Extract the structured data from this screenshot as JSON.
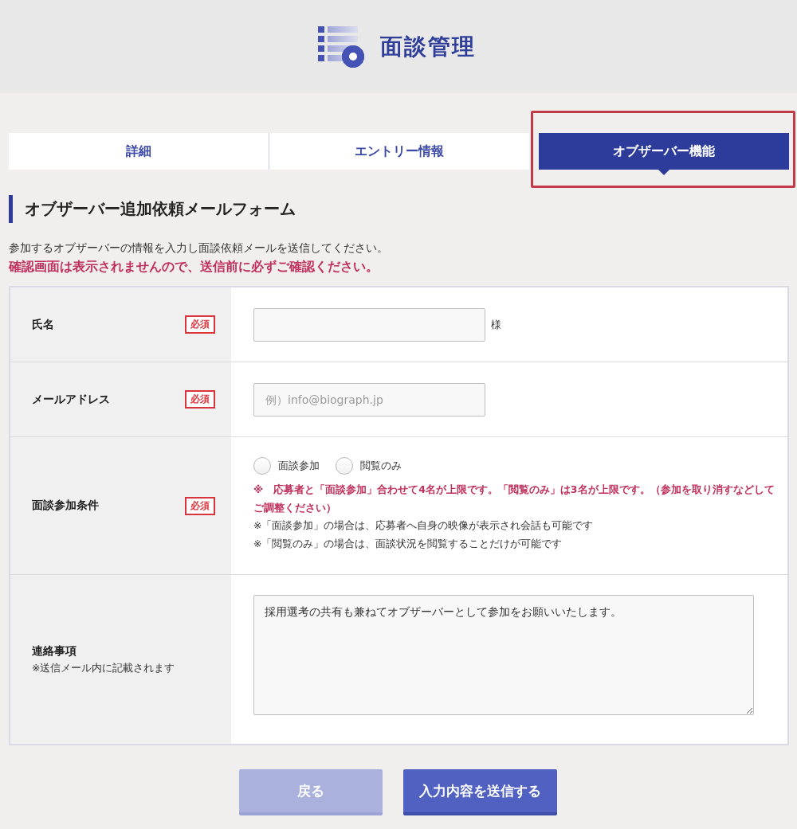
{
  "header": {
    "title": "面談管理"
  },
  "tabs": [
    {
      "label": "詳細",
      "selected": false,
      "highlighted": false
    },
    {
      "label": "エントリー情報",
      "selected": false,
      "highlighted": false
    },
    {
      "label": "オブザーバー機能",
      "selected": true,
      "highlighted": true
    }
  ],
  "section": {
    "title": "オブザーバー追加依頼メールフォーム",
    "description": "参加するオブザーバーの情報を入力し面談依頼メールを送信してください。",
    "warning": "確認画面は表示されませんので、送信前に必ずご確認ください。"
  },
  "form": {
    "rows": [
      {
        "kind": "text",
        "label": "氏名",
        "required": true,
        "badge": "必須",
        "suffix": "様"
      },
      {
        "kind": "text",
        "label": "メールアドレス",
        "required": true,
        "badge": "必須",
        "placeholder": "例）info@biograph.jp"
      },
      {
        "kind": "radio",
        "label": "面談参加条件",
        "required": true,
        "badge": "必須",
        "options": [
          {
            "label": "面談参加",
            "selected": false
          },
          {
            "label": "閲覧のみ",
            "selected": false
          }
        ],
        "notes": [
          {
            "kind": "warning",
            "text": "※　応募者と「面談参加」合わせて4名が上限です。「閲覧のみ」は3名が上限です。（参加を取り消すなどしてご調整ください）"
          },
          {
            "kind": "plain",
            "text": "※「面談参加」の場合は、応募者へ自身の映像が表示され会話も可能です"
          },
          {
            "kind": "plain",
            "text": "※「閲覧のみ」の場合は、面談状況を閲覧することだけが可能です"
          }
        ]
      },
      {
        "kind": "textarea",
        "label": "連絡事項",
        "sublabel": "※送信メール内に記載されます",
        "required": false,
        "value": "採用選考の共有も兼ねてオブザーバーとして参加をお願いいたします。"
      }
    ]
  },
  "buttons": [
    {
      "label": "戻る",
      "kind": "secondary"
    },
    {
      "label": "入力内容を送信する",
      "kind": "primary"
    }
  ]
}
